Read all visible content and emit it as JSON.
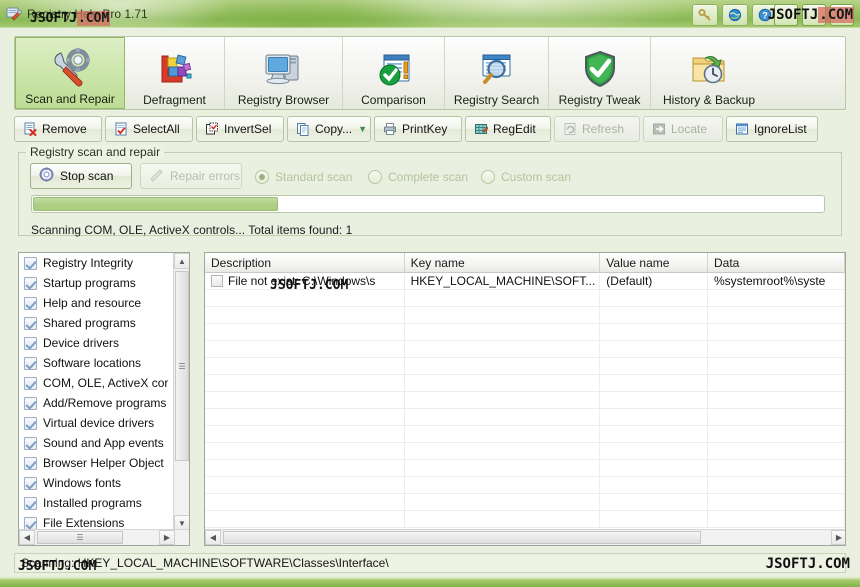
{
  "window": {
    "title": "Registry Help Pro  1.71",
    "icon": "registry-wrench-icon"
  },
  "titlebar_buttons": [
    {
      "name": "key-tools-icon",
      "glyph": "🔑"
    },
    {
      "name": "globe-icon",
      "glyph": "🌐"
    },
    {
      "name": "help-icon",
      "glyph": "?"
    }
  ],
  "window_controls": [
    {
      "name": "minimize-button",
      "glyph": "–"
    },
    {
      "name": "maximize-button",
      "glyph": "□"
    },
    {
      "name": "close-button",
      "glyph": "✕"
    }
  ],
  "main_toolbar": {
    "tabs": [
      {
        "label": "Scan and Repair",
        "icon": "wrench-gear-icon",
        "selected": true
      },
      {
        "label": "Defragment",
        "icon": "defragment-blocks-icon",
        "selected": false
      },
      {
        "label": "Registry Browser",
        "icon": "monitor-pc-icon",
        "selected": false
      },
      {
        "label": "Comparison",
        "icon": "check-document-icon",
        "selected": false
      },
      {
        "label": "Registry Search",
        "icon": "magnifier-window-icon",
        "selected": false
      },
      {
        "label": "Registry Tweak",
        "icon": "green-shield-icon",
        "selected": false
      },
      {
        "label": "History & Backup",
        "icon": "folder-clock-icon",
        "selected": false
      }
    ]
  },
  "action_bar": {
    "buttons": [
      {
        "label": "Remove",
        "icon": "remove-page-icon",
        "enabled": true,
        "dropdown": false
      },
      {
        "label": "SelectAll",
        "icon": "select-all-icon",
        "enabled": true,
        "dropdown": false
      },
      {
        "label": "InvertSel",
        "icon": "invert-select-icon",
        "enabled": true,
        "dropdown": false
      },
      {
        "label": "Copy...",
        "icon": "copy-pages-icon",
        "enabled": true,
        "dropdown": true
      },
      {
        "label": "PrintKey",
        "icon": "printer-icon",
        "enabled": true,
        "dropdown": false
      },
      {
        "label": "RegEdit",
        "icon": "regedit-icon",
        "enabled": true,
        "dropdown": false
      },
      {
        "label": "Refresh",
        "icon": "refresh-icon",
        "enabled": false,
        "dropdown": false
      },
      {
        "label": "Locate",
        "icon": "locate-arrow-icon",
        "enabled": false,
        "dropdown": false
      },
      {
        "label": "IgnoreList",
        "icon": "ignore-list-icon",
        "enabled": true,
        "dropdown": false
      }
    ]
  },
  "scan_group": {
    "title": "Registry scan and repair",
    "stop_button": {
      "label": "Stop scan",
      "icon": "stop-spinner-icon",
      "enabled": true
    },
    "repair_button": {
      "label": "Repair errors",
      "icon": "repair-wand-icon",
      "enabled": false
    },
    "scan_modes": [
      {
        "label": "Standard scan",
        "selected": true,
        "enabled": false
      },
      {
        "label": "Complete scan",
        "selected": false,
        "enabled": false
      },
      {
        "label": "Custom scan",
        "selected": false,
        "enabled": false
      }
    ],
    "progress_percent": 31,
    "status_text": "Scanning COM, OLE, ActiveX controls...  Total items found: 1"
  },
  "categories": {
    "items": [
      {
        "label": "Registry Integrity",
        "checked": true
      },
      {
        "label": "Startup programs",
        "checked": true
      },
      {
        "label": "Help and resource",
        "checked": true
      },
      {
        "label": "Shared programs",
        "checked": true
      },
      {
        "label": "Device drivers",
        "checked": true
      },
      {
        "label": "Software locations",
        "checked": true
      },
      {
        "label": "COM, OLE, ActiveX cor",
        "checked": true
      },
      {
        "label": "Add/Remove programs",
        "checked": true
      },
      {
        "label": "Virtual device drivers",
        "checked": true
      },
      {
        "label": "Sound and App events",
        "checked": true
      },
      {
        "label": "Browser Helper Object",
        "checked": true
      },
      {
        "label": "Windows fonts",
        "checked": true
      },
      {
        "label": "Installed programs",
        "checked": true
      },
      {
        "label": "File Extensions",
        "checked": true
      }
    ]
  },
  "results_table": {
    "columns": [
      "Description",
      "Key name",
      "Value name",
      "Data"
    ],
    "rows": [
      {
        "checked": false,
        "description": "File not exist: C:\\Windows\\s",
        "key_name": "HKEY_LOCAL_MACHINE\\SOFT...",
        "value_name": "(Default)",
        "data": "%systemroot%\\syste"
      }
    ],
    "empty_row_count": 15
  },
  "status_bar": {
    "text": "Scanning: HKEY_LOCAL_MACHINE\\SOFTWARE\\Classes\\Interface\\"
  },
  "watermark": {
    "text_a": "JSOFTJ",
    "text_b": ".COM",
    "full": "JSOFTJ.COM"
  },
  "scrollbars": {
    "left_up": "▲",
    "left_down": "▼",
    "arrow_left": "◄",
    "arrow_right": "►",
    "grip": "‖"
  },
  "colors": {
    "titlebar_green": "#9cc368",
    "selected_tab": "#cbe5a9",
    "panel_bg": "#edf2e2",
    "progress_fill": "#afd086",
    "accent_red": "#d66c60"
  }
}
